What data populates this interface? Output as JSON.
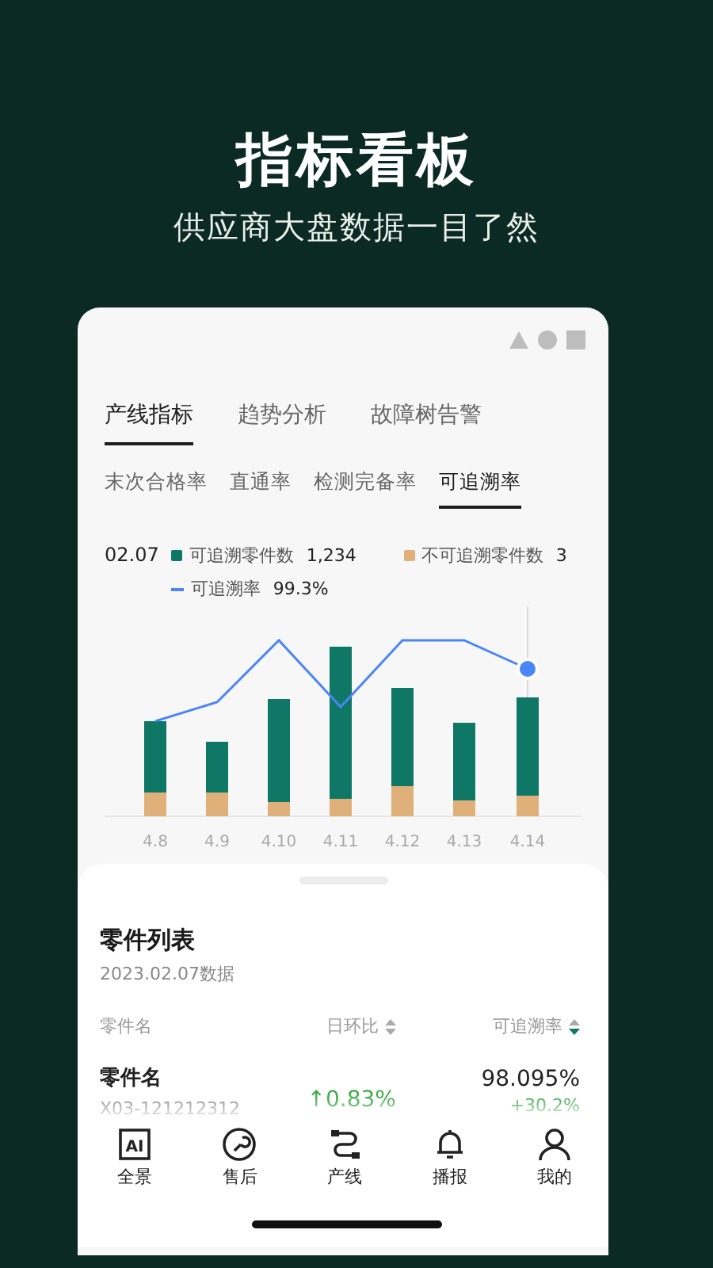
{
  "headline": {
    "title": "指标看板",
    "subtitle": "供应商大盘数据一目了然"
  },
  "tabs": [
    {
      "label": "产线指标",
      "selected": true
    },
    {
      "label": "趋势分析",
      "selected": false
    },
    {
      "label": "故障树告警",
      "selected": false
    }
  ],
  "subtabs": [
    {
      "label": "末次合格率",
      "selected": false
    },
    {
      "label": "直通率",
      "selected": false
    },
    {
      "label": "检测完备率",
      "selected": false
    },
    {
      "label": "可追溯率",
      "selected": true
    }
  ],
  "legend": {
    "date": "02.07",
    "items": [
      {
        "kind": "square",
        "color": "#0e7766",
        "label": "可追溯零件数",
        "value": "1,234"
      },
      {
        "kind": "square",
        "color": "#dfb07a",
        "label": "不可追溯零件数",
        "value": "3"
      },
      {
        "kind": "line",
        "color": "#4a86f5",
        "label": "可追溯率",
        "value": "99.3%"
      }
    ]
  },
  "chart": {
    "x_labels": [
      "4.8",
      "4.9",
      "4.10",
      "4.11",
      "4.12",
      "4.13",
      "4.14"
    ]
  },
  "parts": {
    "title": "零件列表",
    "date": "2023.02.07数据",
    "columns": [
      {
        "label": "零件名"
      },
      {
        "label": "日环比",
        "sort_active": false
      },
      {
        "label": "可追溯率",
        "sort_active": true
      }
    ],
    "rows": [
      {
        "name": "零件名",
        "code": "X03-121212312",
        "change": "↑0.83%",
        "rate": "98.095%",
        "rate_change": "+30.2%"
      }
    ]
  },
  "nav": [
    {
      "kind": "text-box",
      "icon_text": "AI",
      "label": "全景"
    },
    {
      "kind": "wrench",
      "label": "售后"
    },
    {
      "kind": "cable",
      "label": "产线"
    },
    {
      "kind": "bell",
      "label": "播报"
    },
    {
      "kind": "person",
      "label": "我的"
    }
  ]
}
